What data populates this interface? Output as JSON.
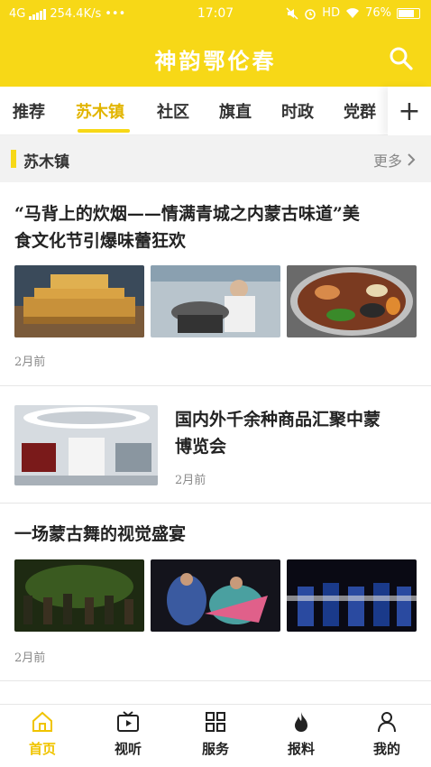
{
  "status_bar": {
    "network": "4G",
    "speed": "254.4K/s",
    "dots": "•••",
    "time": "17:07",
    "hd": "HD",
    "battery": "76%"
  },
  "header": {
    "title": "神韵鄂伦春",
    "search_icon": "search-icon"
  },
  "tabs": [
    {
      "label": "推荐",
      "active": false
    },
    {
      "label": "苏木镇",
      "active": true
    },
    {
      "label": "社区",
      "active": false
    },
    {
      "label": "旗直",
      "active": false
    },
    {
      "label": "时政",
      "active": false
    },
    {
      "label": "党群",
      "active": false
    }
  ],
  "section": {
    "name": "苏木镇",
    "more": "更多"
  },
  "articles": [
    {
      "title_line1": "“马背上的炊烟——情满青城之内蒙古味道”美",
      "title_line2": "食文化节引爆味蕾狂欢",
      "time": "2月前"
    },
    {
      "title_line1": "国内外千余种商品汇聚中蒙",
      "title_line2": "博览会",
      "time": "2月前"
    },
    {
      "title_line1": "一场蒙古舞的视觉盛宴",
      "time": "2月前"
    }
  ],
  "bottom_nav": [
    {
      "label": "首页",
      "icon": "home-icon",
      "active": true
    },
    {
      "label": "视听",
      "icon": "tv-icon",
      "active": false
    },
    {
      "label": "服务",
      "icon": "grid-icon",
      "active": false
    },
    {
      "label": "报料",
      "icon": "flame-icon",
      "active": false
    },
    {
      "label": "我的",
      "icon": "user-icon",
      "active": false
    }
  ],
  "colors": {
    "brand": "#f7d817",
    "active_text": "#e2b500"
  }
}
